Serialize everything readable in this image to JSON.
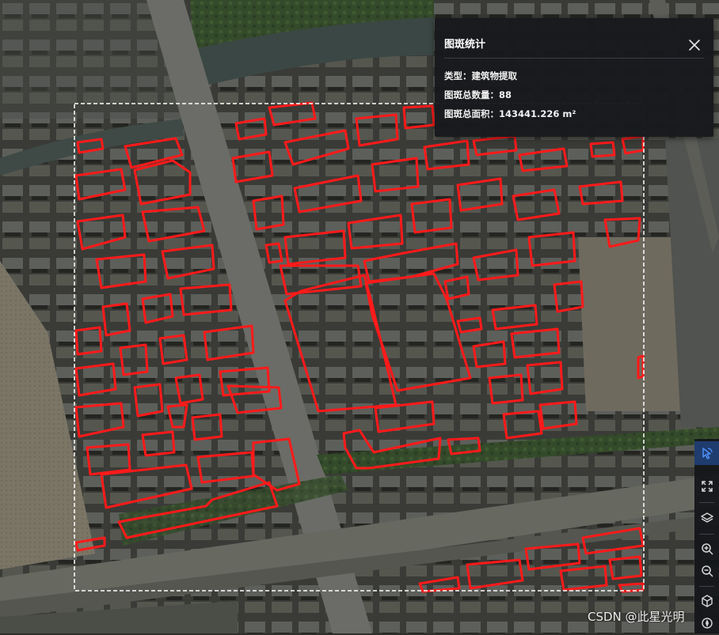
{
  "panel": {
    "title": "图斑统计",
    "type_label": "类型：",
    "type_value": "建筑物提取",
    "count_label": "图斑总数量：",
    "count_value": "88",
    "area_label": "图斑总面积：",
    "area_value": "143441.226 m²"
  },
  "toolbar": {
    "tools": [
      {
        "icon": "pointer-select-icon",
        "active": true
      },
      {
        "icon": "fullscreen-icon",
        "active": false
      },
      {
        "icon": "layers-icon",
        "active": false
      },
      {
        "icon": "zoom-in-icon",
        "active": false
      },
      {
        "icon": "zoom-out-icon",
        "active": false
      },
      {
        "icon": "3d-view-icon",
        "active": false
      },
      {
        "icon": "compass-icon",
        "active": false
      }
    ]
  },
  "watermark": "CSDN @此星光明",
  "colors": {
    "patch_outline": "#ff1a1a",
    "selection_box": "#ffffff",
    "panel_bg": "#18191d",
    "active_tool": "#1f3c6e"
  }
}
